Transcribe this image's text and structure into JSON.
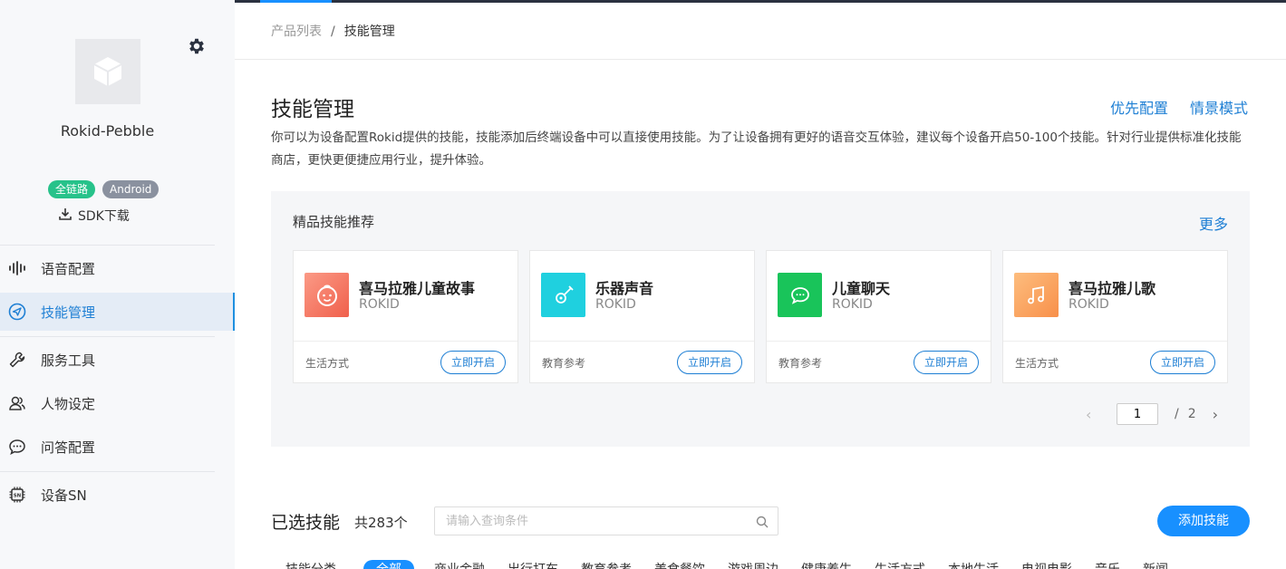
{
  "sidebar": {
    "product_name": "Rokid-Pebble",
    "badges": [
      "全链路",
      "Android"
    ],
    "sdk_label": "SDK下载",
    "nav": [
      {
        "label": "语音配置",
        "icon": "waveform-icon"
      },
      {
        "label": "技能管理",
        "icon": "send-icon"
      },
      {
        "label": "服务工具",
        "icon": "wrench-icon"
      },
      {
        "label": "人物设定",
        "icon": "users-icon"
      },
      {
        "label": "问答配置",
        "icon": "chat-icon"
      },
      {
        "label": "设备SN",
        "icon": "chip-icon"
      }
    ]
  },
  "breadcrumb": {
    "parent": "产品列表",
    "separator": "/",
    "current": "技能管理"
  },
  "header": {
    "title": "技能管理",
    "link_priority": "优先配置",
    "link_scene": "情景模式",
    "description": "你可以为设备配置Rokid提供的技能，技能添加后终端设备中可以直接使用技能。为了让设备拥有更好的语音交互体验，建议每个设备开启50-100个技能。针对行业提供标准化技能商店，更快更便捷应用行业，提升体验。"
  },
  "featured": {
    "title": "精品技能推荐",
    "more": "更多",
    "cards": [
      {
        "name": "喜马拉雅儿童故事",
        "vendor": "ROKID",
        "category": "生活方式",
        "button": "立即开启",
        "icon": "baby-face-icon",
        "color": "#f77a6a"
      },
      {
        "name": "乐器声音",
        "vendor": "ROKID",
        "category": "教育参考",
        "button": "立即开启",
        "icon": "guitar-icon",
        "color": "#1fd0df"
      },
      {
        "name": "儿童聊天",
        "vendor": "ROKID",
        "category": "教育参考",
        "button": "立即开启",
        "icon": "chat-bubble-icon",
        "color": "#19c45a"
      },
      {
        "name": "喜马拉雅儿歌",
        "vendor": "ROKID",
        "category": "生活方式",
        "button": "立即开启",
        "icon": "music-note-icon",
        "color": "#fba05a"
      }
    ],
    "pager": {
      "current": "1",
      "separator": "/",
      "total": "2"
    }
  },
  "selected": {
    "title": "已选技能",
    "count": "共283个",
    "search_placeholder": "请输入查询条件",
    "add_button": "添加技能"
  },
  "filters": {
    "label": "技能分类",
    "items": [
      "全部",
      "商业金融",
      "出行打车",
      "教育参考",
      "美食餐饮",
      "游戏周边",
      "健康养生",
      "生活方式",
      "本地生活",
      "电视电影",
      "音乐",
      "新闻"
    ]
  },
  "colors": {
    "accent": "#1890ff",
    "link": "#1e7fd4",
    "badge_green": "#27c28a",
    "badge_gray": "#8a919f"
  }
}
